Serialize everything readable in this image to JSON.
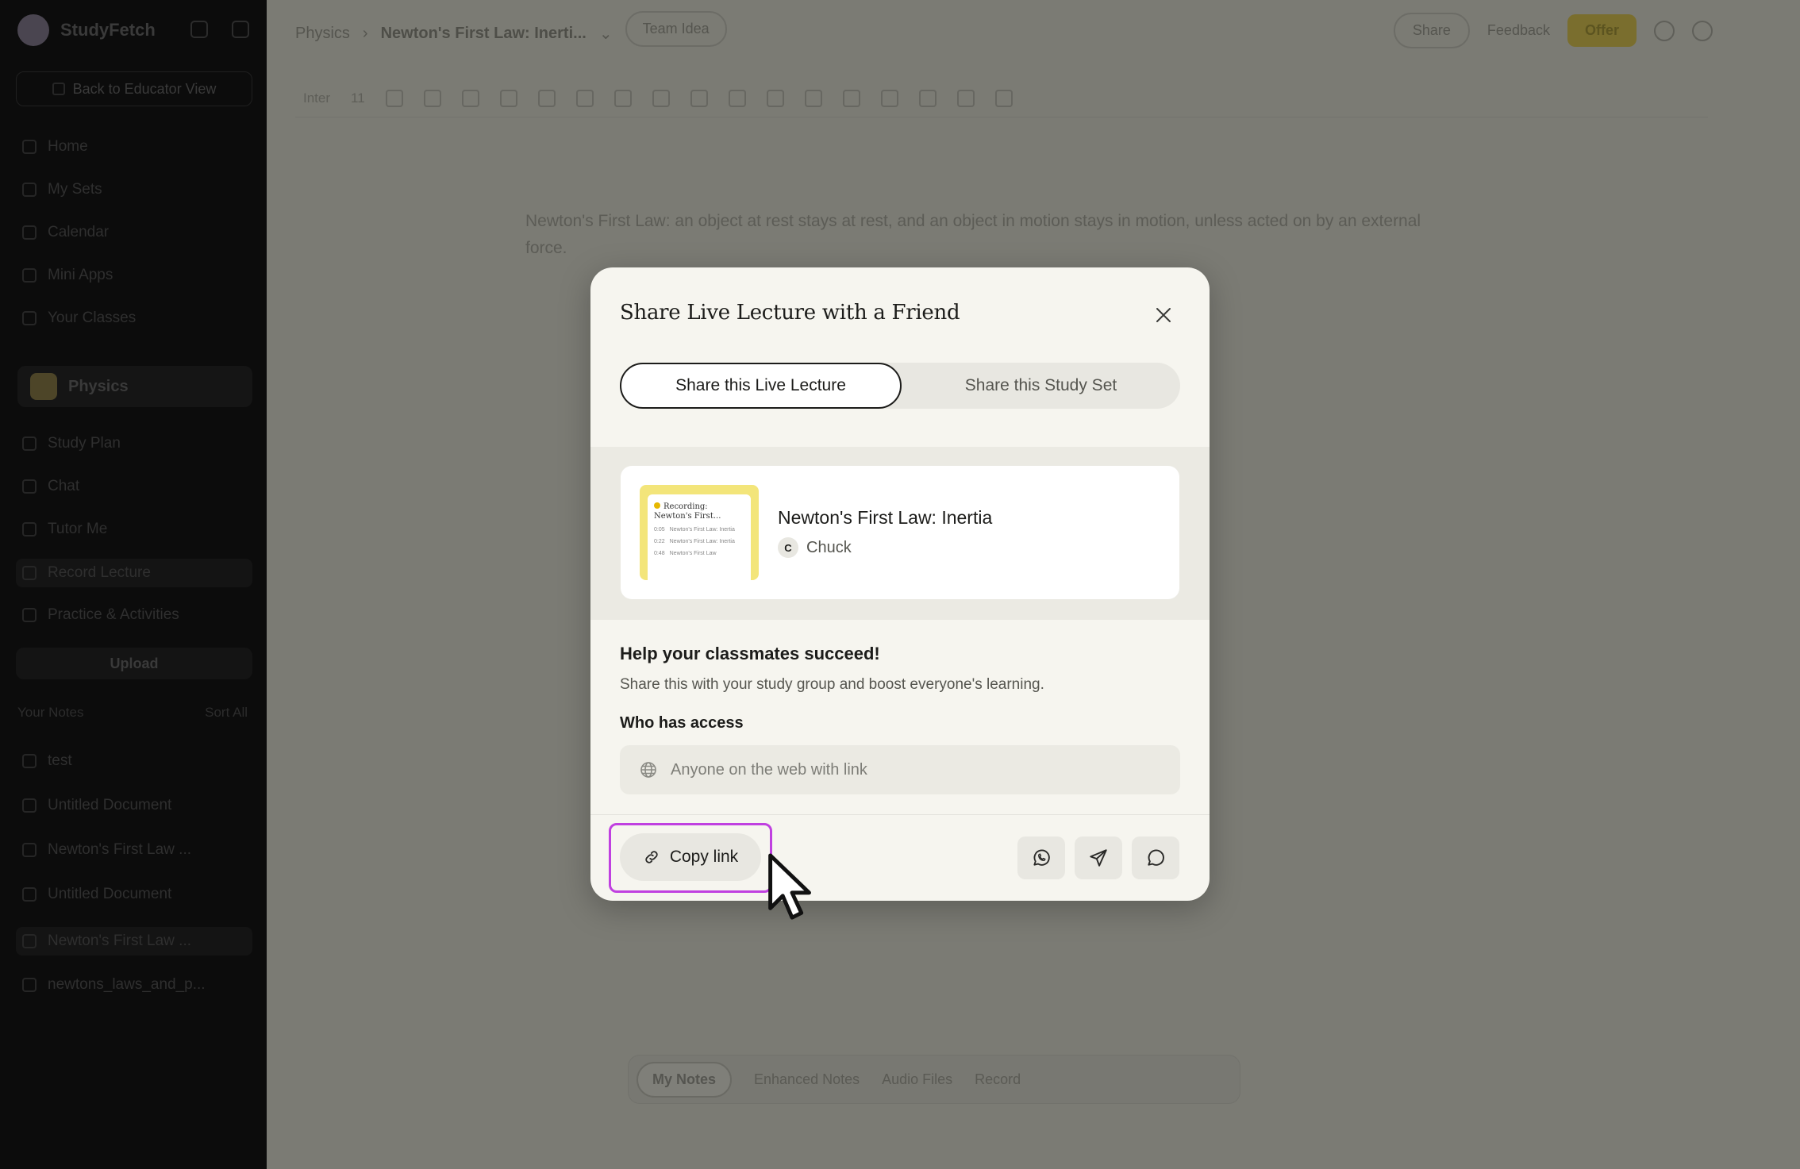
{
  "sidebar": {
    "brand": "StudyFetch",
    "back_label": "Back to Educator View",
    "nav": [
      "Home",
      "My Sets",
      "Calendar",
      "Mini Apps",
      "Your Classes"
    ],
    "class_name": "Physics",
    "class_nav": [
      "Study Plan",
      "Chat",
      "Tutor Me",
      "Record Lecture",
      "Practice & Activities"
    ],
    "upload_label": "Upload",
    "notes_header": "Your Notes",
    "notes_sort": "Sort All",
    "notes": [
      "test",
      "Untitled Document",
      "Newton's First Law ...",
      "Untitled Document",
      "Newton's First Law ...",
      "newtons_laws_and_p..."
    ]
  },
  "topbar": {
    "breadcrumb_root": "Physics",
    "breadcrumb_doc": "Newton's First Law: Inerti...",
    "team_label": "Team Idea",
    "share_label": "Share",
    "feedback_label": "Feedback",
    "offer_label": "Offer"
  },
  "toolbar": {
    "font": "Inter",
    "size": "11"
  },
  "document": {
    "text": "Newton's First Law: an object at rest stays at rest, and an object in motion stays in motion, unless acted on by an external force."
  },
  "bottom_bar": {
    "tabs": [
      "My Notes",
      "Enhanced Notes",
      "Audio Files",
      "Record"
    ]
  },
  "modal": {
    "title": "Share Live Lecture with a Friend",
    "tabs": [
      "Share this Live Lecture",
      "Share this Study Set"
    ],
    "active_tab": 0,
    "card": {
      "title": "Newton's First Law: Inertia",
      "author_initial": "C",
      "author": "Chuck",
      "thumb_title": "Recording: Newton's First...",
      "thumb_rows": [
        {
          "time": "0:05",
          "text": "Newton's First Law: Inertia"
        },
        {
          "time": "0:22",
          "text": "Newton's First Law: Inertia"
        },
        {
          "time": "0:48",
          "text": "Newton's First Law"
        }
      ]
    },
    "help_title": "Help your classmates succeed!",
    "help_sub": "Share this with your study group and boost everyone's learning.",
    "access_label": "Who has access",
    "access_value": "Anyone on the web with link",
    "copy_label": "Copy link",
    "social_icons": [
      "whatsapp-icon",
      "telegram-icon",
      "message-icon"
    ],
    "highlight_color": "#c040e0"
  }
}
